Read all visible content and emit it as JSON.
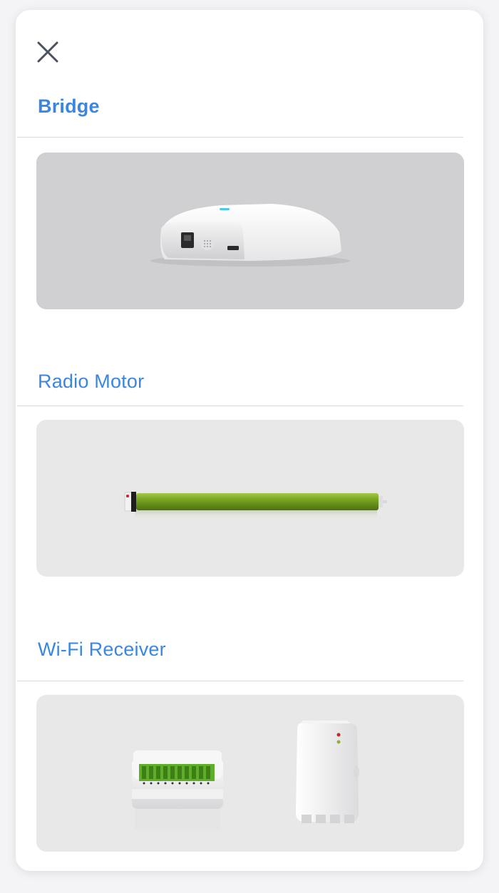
{
  "sheet": {
    "close_icon": "close-icon"
  },
  "sections": [
    {
      "title": "Bridge",
      "product": "bridge-device-image"
    },
    {
      "title": "Radio Motor",
      "product": "tubular-motor-image"
    },
    {
      "title": "Wi-Fi Receiver",
      "product": "wifi-receiver-image"
    }
  ],
  "colors": {
    "accent": "#3a86e0",
    "card_bg_bridge": "#d0d0d2",
    "card_bg_other": "#e8e8e8",
    "motor_green": "#6e9a1e"
  }
}
